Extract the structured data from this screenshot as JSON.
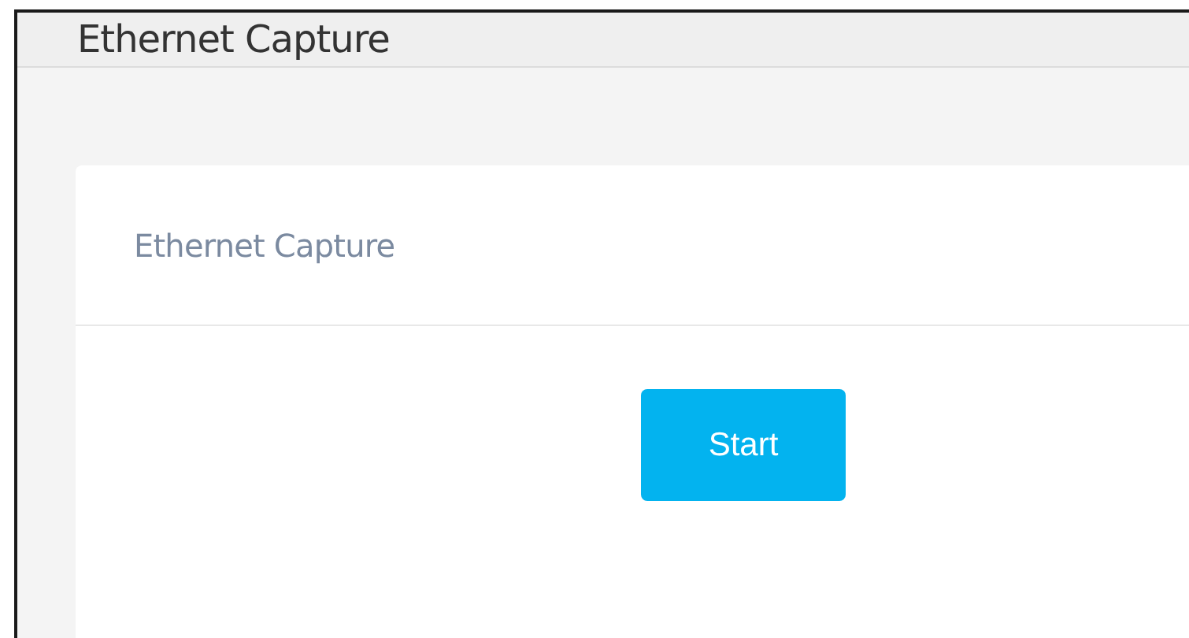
{
  "header": {
    "title": "Ethernet Capture"
  },
  "card": {
    "title": "Ethernet Capture",
    "button": "Start"
  }
}
